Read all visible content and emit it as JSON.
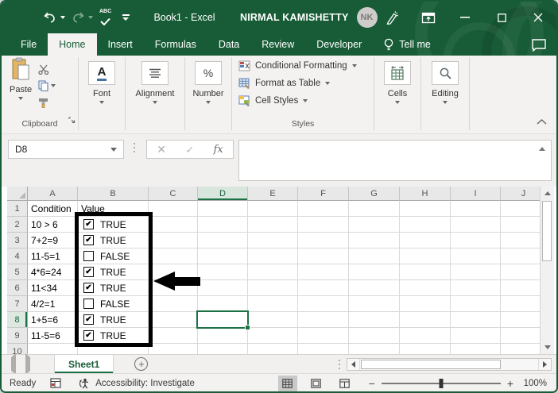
{
  "window": {
    "title": "Book1 - Excel",
    "user_name": "NIRMAL KAMISHETTY",
    "avatar": "NK"
  },
  "ribbon_tabs": [
    {
      "label": "File",
      "active": false
    },
    {
      "label": "Home",
      "active": true
    },
    {
      "label": "Insert",
      "active": false
    },
    {
      "label": "Formulas",
      "active": false
    },
    {
      "label": "Data",
      "active": false
    },
    {
      "label": "Review",
      "active": false
    },
    {
      "label": "Developer",
      "active": false
    }
  ],
  "tell_me_label": "Tell me",
  "ribbon": {
    "clipboard": {
      "paste_label": "Paste",
      "group_label": "Clipboard"
    },
    "font": {
      "label": "Font"
    },
    "alignment": {
      "label": "Alignment"
    },
    "number": {
      "label": "Number"
    },
    "styles": {
      "items": [
        "Conditional Formatting",
        "Format as Table",
        "Cell Styles"
      ],
      "group_label": "Styles"
    },
    "cells": {
      "label": "Cells"
    },
    "editing": {
      "label": "Editing"
    }
  },
  "formula_bar": {
    "name_box": "D8",
    "fx_label": "fx",
    "formula_value": ""
  },
  "grid": {
    "column_headers": [
      "A",
      "B",
      "C",
      "D",
      "E",
      "F",
      "G",
      "H",
      "I",
      "J"
    ],
    "selected_column": "D",
    "selected_row": 8,
    "selected_cell": "D8",
    "rows": [
      {
        "n": "1",
        "a": "Condition",
        "b_text": "Value",
        "checkbox": null
      },
      {
        "n": "2",
        "a": "10 > 6",
        "b_text": "TRUE",
        "checkbox": "checked"
      },
      {
        "n": "3",
        "a": "7+2=9",
        "b_text": "TRUE",
        "checkbox": "checked"
      },
      {
        "n": "4",
        "a": "11-5=1",
        "b_text": "FALSE",
        "checkbox": "unchecked"
      },
      {
        "n": "5",
        "a": "4*6=24",
        "b_text": "TRUE",
        "checkbox": "checked"
      },
      {
        "n": "6",
        "a": "11<34",
        "b_text": "TRUE",
        "checkbox": "checked"
      },
      {
        "n": "7",
        "a": "4/2=1",
        "b_text": "FALSE",
        "checkbox": "unchecked"
      },
      {
        "n": "8",
        "a": "1+5=6",
        "b_text": "TRUE",
        "checkbox": "checked"
      },
      {
        "n": "9",
        "a": "11-5=6",
        "b_text": "TRUE",
        "checkbox": "checked"
      },
      {
        "n": "10",
        "a": "",
        "b_text": "",
        "checkbox": null
      }
    ]
  },
  "sheet_bar": {
    "active_tab": "Sheet1"
  },
  "status_bar": {
    "ready": "Ready",
    "accessibility": "Accessibility: Investigate",
    "zoom_level": "100%"
  },
  "colors": {
    "title_green": "#185c37",
    "accent_green": "#217346",
    "selection_green": "#1e7145"
  }
}
